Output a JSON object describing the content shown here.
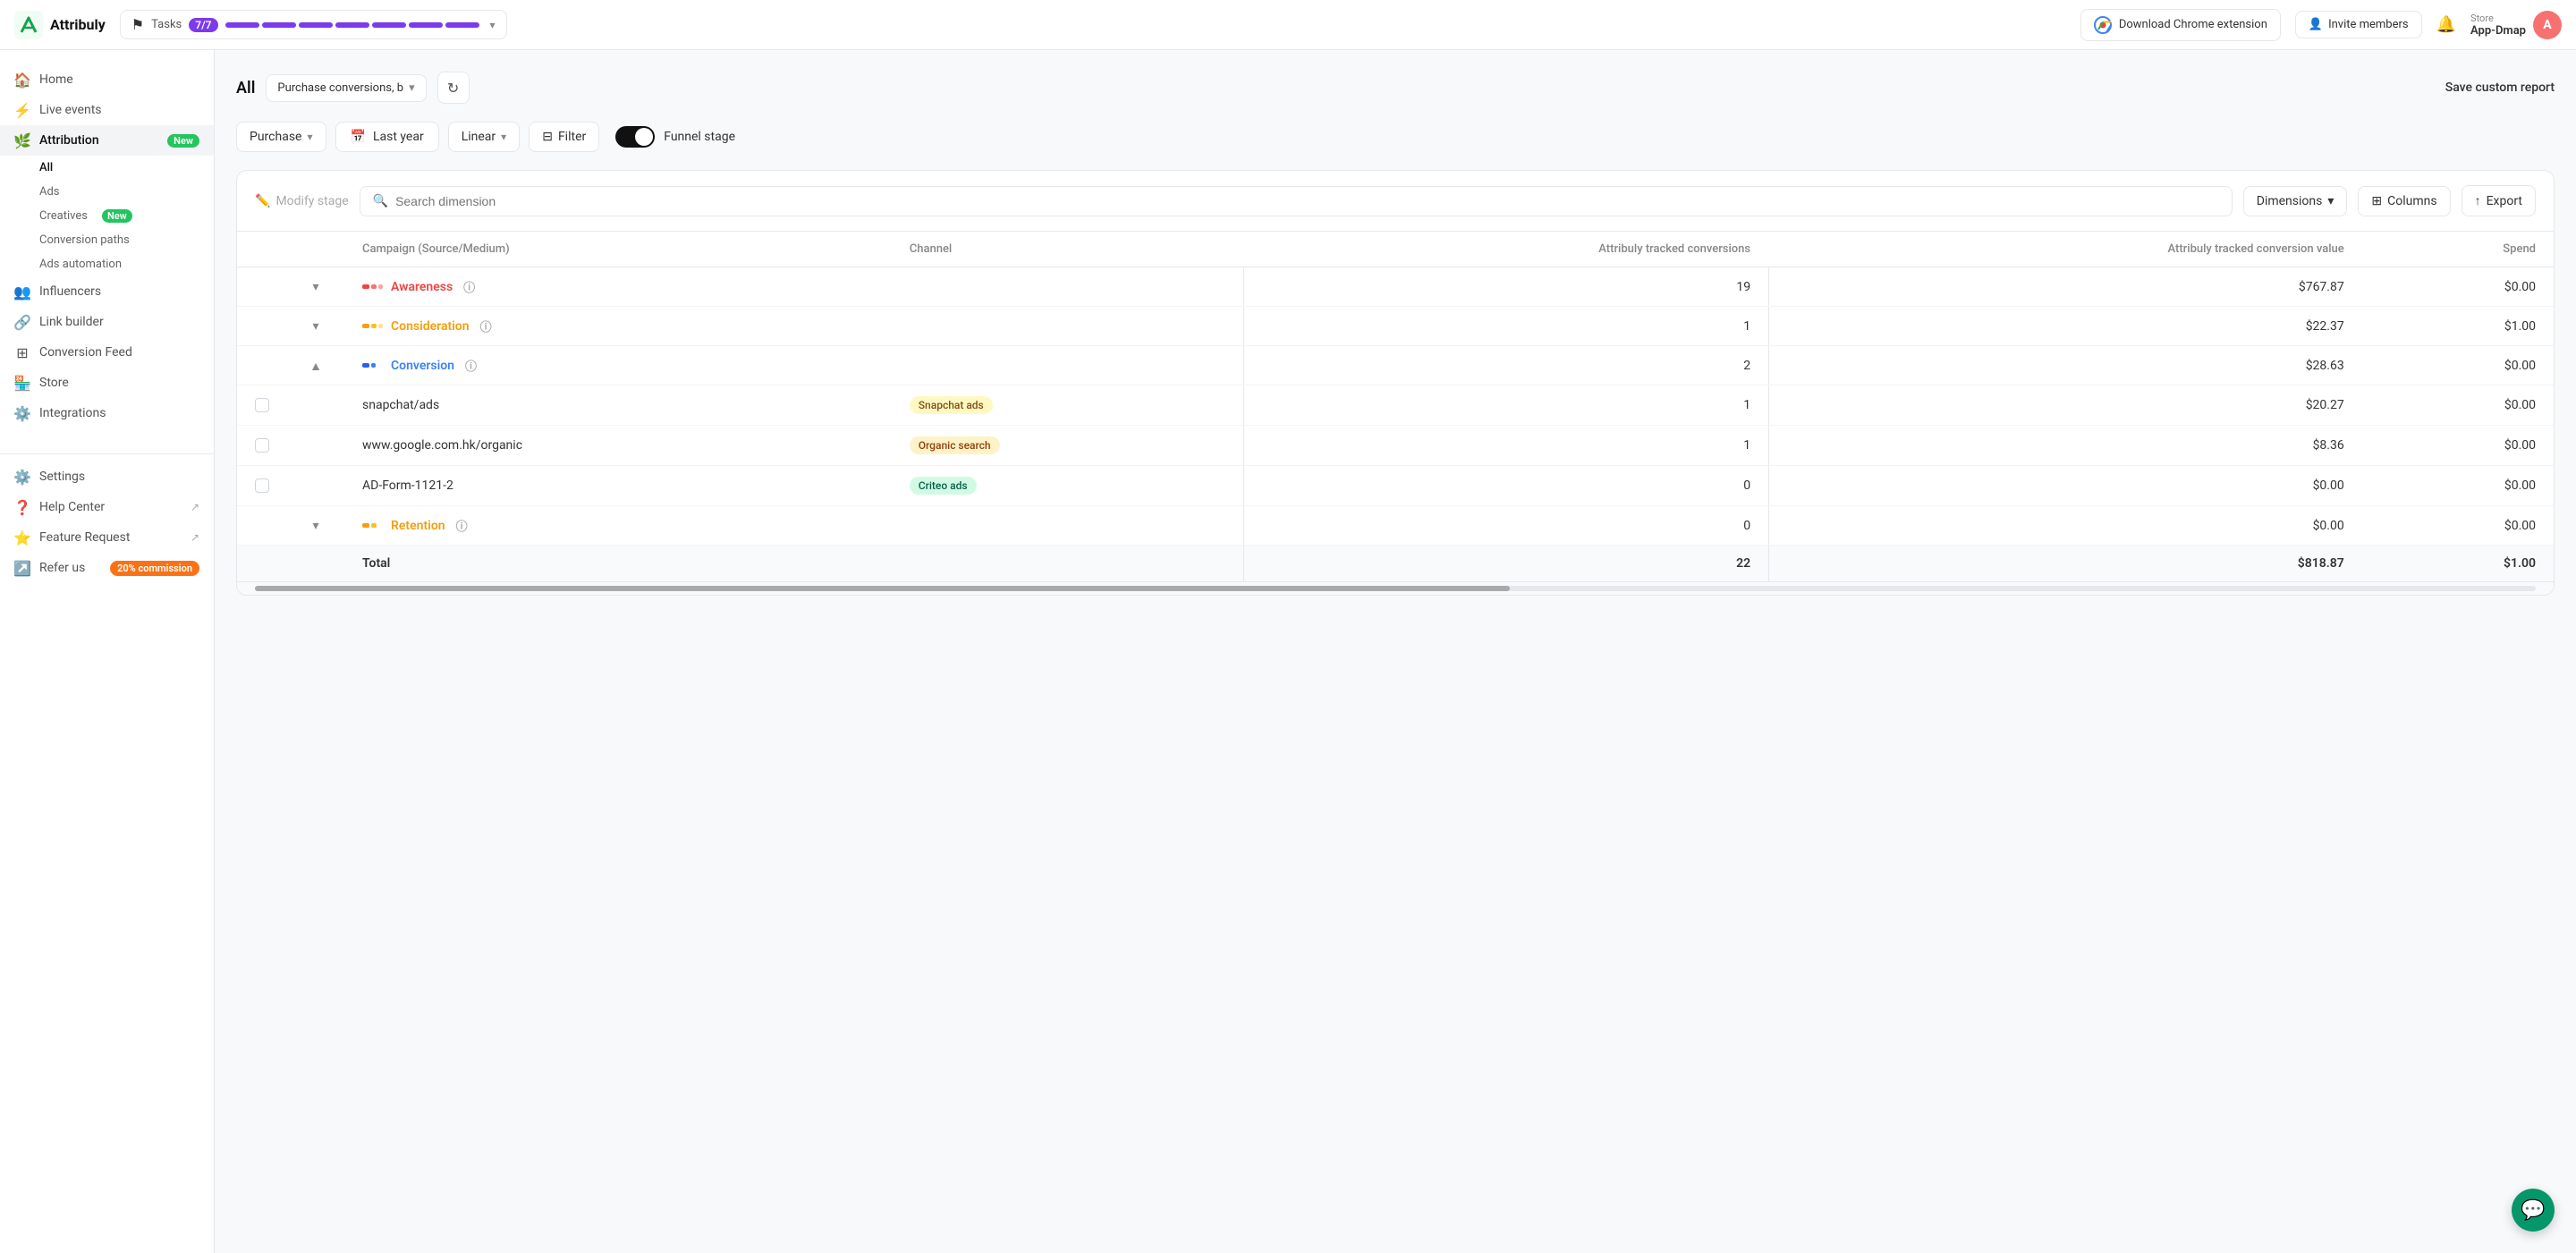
{
  "app": {
    "name": "Attribuly"
  },
  "topbar": {
    "tasks_label": "Tasks",
    "tasks_badge": "7/7",
    "chrome_ext_label": "Download Chrome extension",
    "invite_label": "Invite members",
    "store_label": "Store",
    "store_name": "App-Dmap",
    "avatar_letter": "A",
    "save_report_label": "Save custom report"
  },
  "progress_segments": [
    {
      "filled": true
    },
    {
      "filled": true
    },
    {
      "filled": true
    },
    {
      "filled": true
    },
    {
      "filled": true
    },
    {
      "filled": true
    },
    {
      "filled": true
    }
  ],
  "sidebar": {
    "items": [
      {
        "id": "home",
        "label": "Home",
        "icon": "🏠",
        "active": false
      },
      {
        "id": "live-events",
        "label": "Live events",
        "icon": "⚡",
        "active": false
      },
      {
        "id": "attribution",
        "label": "Attribution",
        "icon": "🌿",
        "active": true,
        "badge": "New"
      },
      {
        "id": "influencers",
        "label": "Influencers",
        "icon": "👥",
        "active": false
      },
      {
        "id": "link-builder",
        "label": "Link builder",
        "icon": "🔗",
        "active": false
      },
      {
        "id": "conversion-feed",
        "label": "Conversion Feed",
        "icon": "⬛",
        "active": false
      },
      {
        "id": "store",
        "label": "Store",
        "icon": "🏪",
        "active": false
      },
      {
        "id": "integrations",
        "label": "Integrations",
        "icon": "⚙️",
        "active": false
      }
    ],
    "attribution_sub": [
      {
        "id": "all",
        "label": "All",
        "active": true
      },
      {
        "id": "ads",
        "label": "Ads",
        "active": false
      },
      {
        "id": "creatives",
        "label": "Creatives",
        "active": false,
        "badge": "New"
      },
      {
        "id": "conversion-paths",
        "label": "Conversion paths",
        "active": false
      },
      {
        "id": "ads-automation",
        "label": "Ads automation",
        "active": false
      }
    ],
    "bottom_items": [
      {
        "id": "settings",
        "label": "Settings",
        "icon": "⚙️"
      },
      {
        "id": "help-center",
        "label": "Help Center",
        "icon": "❓"
      },
      {
        "id": "feature-request",
        "label": "Feature Request",
        "icon": "⭐"
      },
      {
        "id": "refer-us",
        "label": "Refer us",
        "icon": "↗️",
        "badge": "20% commission"
      }
    ]
  },
  "content": {
    "all_label": "All",
    "report_select": "Purchase conversions, b",
    "filters": {
      "conversion": "Purchase",
      "date": "Last year",
      "attribution": "Linear",
      "filter_label": "Filter",
      "funnel_label": "Funnel stage"
    },
    "toolbar": {
      "modify_stage": "Modify stage",
      "search_placeholder": "Search dimension",
      "dimensions_label": "Dimensions",
      "columns_label": "Columns",
      "export_label": "Export"
    },
    "table": {
      "headers": [
        {
          "key": "campaign",
          "label": "Campaign (Source/Medium)",
          "align": "left"
        },
        {
          "key": "channel",
          "label": "Channel",
          "align": "left"
        },
        {
          "key": "conversions",
          "label": "Attribuly tracked conversions",
          "align": "right"
        },
        {
          "key": "conv_value",
          "label": "Attribuly tracked conversion value",
          "align": "right"
        },
        {
          "key": "spend",
          "label": "Spend",
          "align": "right"
        }
      ],
      "stage_rows": [
        {
          "id": "awareness",
          "label": "Awareness",
          "color_class": "awareness-color",
          "bar_colors": [
            "#ef4444",
            "#f87171",
            "#fca5a5"
          ],
          "conversions": "19",
          "conv_value": "$767.87",
          "spend": "$0.00",
          "expanded": false,
          "sub_rows": []
        },
        {
          "id": "consideration",
          "label": "Consideration",
          "color_class": "consideration-color",
          "bar_colors": [
            "#f59e0b",
            "#fbbf24",
            "#fde68a"
          ],
          "conversions": "1",
          "conv_value": "$22.37",
          "spend": "$1.00",
          "expanded": false,
          "sub_rows": []
        },
        {
          "id": "conversion",
          "label": "Conversion",
          "color_class": "conversion-color",
          "bar_colors": [
            "#2563eb",
            "#3b82f6"
          ],
          "conversions": "2",
          "conv_value": "$28.63",
          "spend": "$0.00",
          "expanded": true,
          "sub_rows": [
            {
              "campaign": "snapchat/ads",
              "channel": "Snapchat ads",
              "channel_class": "snapchat-badge",
              "conversions": "1",
              "conv_value": "$20.27",
              "spend": "$0.00",
              "is_linked": true
            },
            {
              "campaign": "www.google.com.hk/organic",
              "channel": "Organic search",
              "channel_class": "organic-badge",
              "conversions": "1",
              "conv_value": "$8.36",
              "spend": "$0.00",
              "is_linked": true
            },
            {
              "campaign": "AD-Form-1121-2",
              "channel": "Criteo ads",
              "channel_class": "criteo-badge",
              "conversions": "0",
              "conv_value": "$0.00",
              "spend": "$0.00",
              "is_linked": true
            }
          ]
        },
        {
          "id": "retention",
          "label": "Retention",
          "color_class": "retention-color",
          "bar_colors": [
            "#f59e0b",
            "#fbbf24"
          ],
          "conversions": "0",
          "conv_value": "$0.00",
          "spend": "$0.00",
          "expanded": false,
          "sub_rows": []
        }
      ],
      "total_row": {
        "label": "Total",
        "conversions": "22",
        "conv_value": "$818.87",
        "spend": "$1.00"
      }
    }
  }
}
